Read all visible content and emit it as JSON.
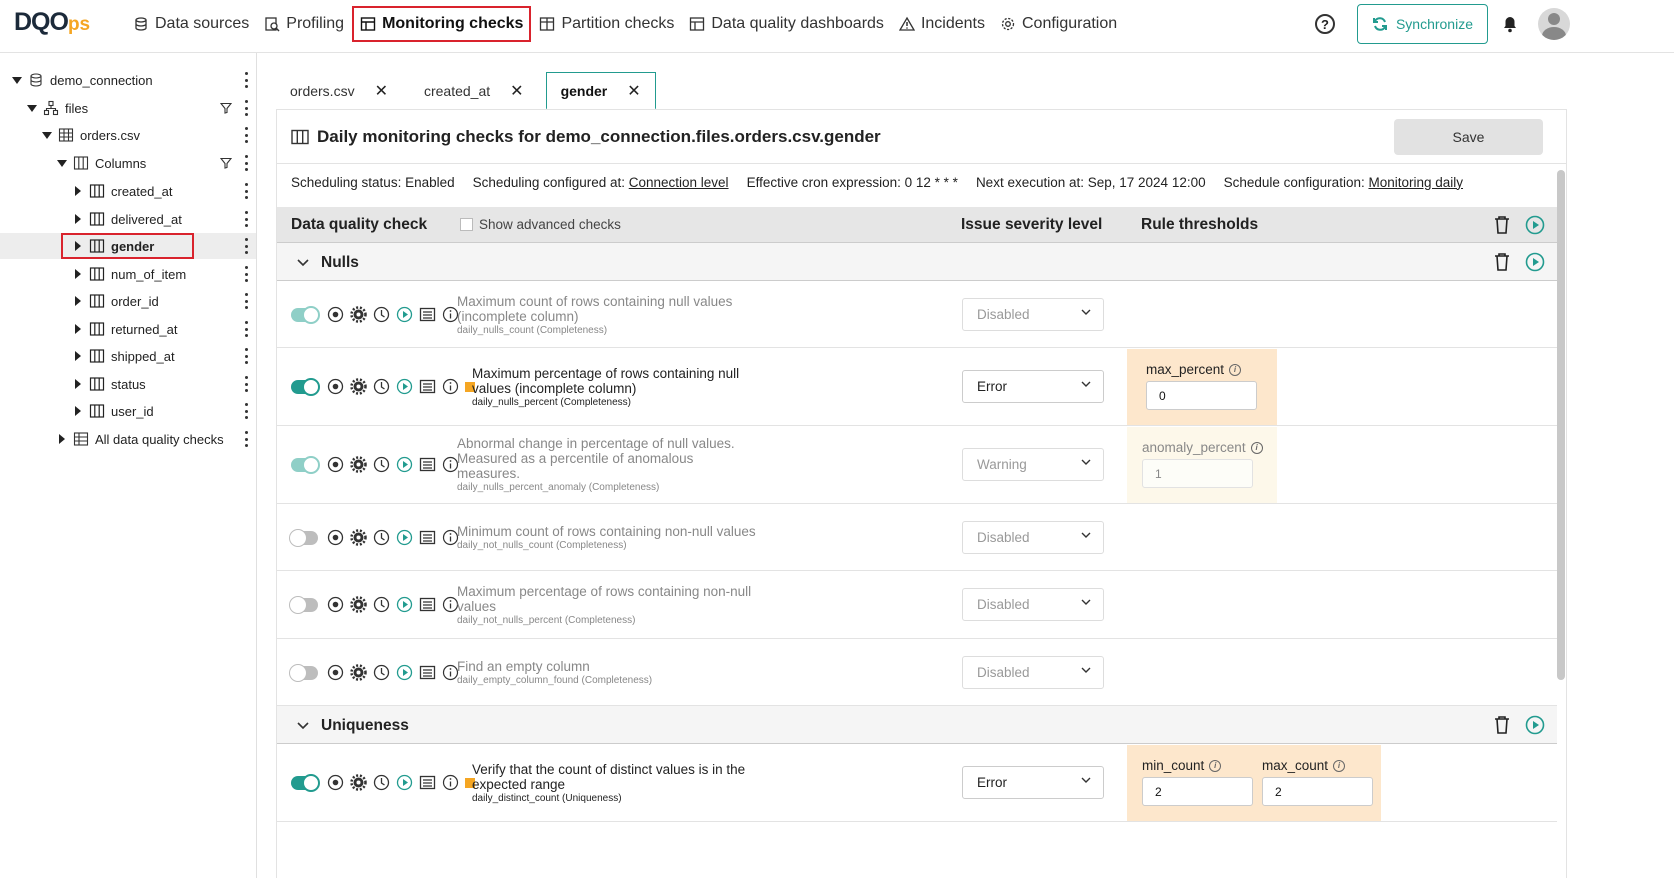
{
  "app": {
    "logo_main": "DQO",
    "logo_sub": "ps"
  },
  "nav": [
    {
      "id": "data-sources",
      "label": "Data sources",
      "icon": "database-icon"
    },
    {
      "id": "profiling",
      "label": "Profiling",
      "icon": "profiling-icon"
    },
    {
      "id": "monitoring-checks",
      "label": "Monitoring checks",
      "icon": "monitoring-icon",
      "active": true
    },
    {
      "id": "partition-checks",
      "label": "Partition checks",
      "icon": "partition-icon"
    },
    {
      "id": "dashboards",
      "label": "Data quality dashboards",
      "icon": "dashboard-icon"
    },
    {
      "id": "incidents",
      "label": "Incidents",
      "icon": "warning-icon"
    },
    {
      "id": "configuration",
      "label": "Configuration",
      "icon": "gear-icon"
    }
  ],
  "top_right": {
    "help": "?",
    "sync_label": "Synchronize"
  },
  "tree": [
    {
      "label": "demo_connection",
      "level": 0,
      "expanded": true,
      "icon": "database-icon"
    },
    {
      "label": "files",
      "level": 1,
      "expanded": true,
      "icon": "schema-icon",
      "filter": true
    },
    {
      "label": "orders.csv",
      "level": 2,
      "expanded": true,
      "icon": "table-icon"
    },
    {
      "label": "Columns",
      "level": 3,
      "expanded": true,
      "icon": "columns-icon",
      "filter": true
    },
    {
      "label": "created_at",
      "level": 4,
      "icon": "column-icon"
    },
    {
      "label": "delivered_at",
      "level": 4,
      "icon": "column-icon"
    },
    {
      "label": "gender",
      "level": 4,
      "icon": "column-icon",
      "selected": true
    },
    {
      "label": "num_of_item",
      "level": 4,
      "icon": "column-icon"
    },
    {
      "label": "order_id",
      "level": 4,
      "icon": "column-icon"
    },
    {
      "label": "returned_at",
      "level": 4,
      "icon": "column-icon"
    },
    {
      "label": "shipped_at",
      "level": 4,
      "icon": "column-icon"
    },
    {
      "label": "status",
      "level": 4,
      "icon": "column-icon"
    },
    {
      "label": "user_id",
      "level": 4,
      "icon": "column-icon"
    },
    {
      "label": "All data quality checks",
      "level": 3,
      "icon": "checks-table-icon"
    }
  ],
  "tabs": [
    {
      "label": "orders.csv"
    },
    {
      "label": "created_at"
    },
    {
      "label": "gender",
      "active": true
    }
  ],
  "panel": {
    "title": "Daily monitoring checks for demo_connection.files.orders.csv.gender",
    "save_label": "Save",
    "sched": {
      "status": "Scheduling status: Enabled",
      "configured_prefix": "Scheduling configured at: ",
      "configured_link": "Connection level",
      "cron": "Effective cron expression: 0 12 * * *",
      "next": "Next execution at: Sep, 17 2024 12:00",
      "config_prefix": "Schedule configuration: ",
      "config_link": "Monitoring daily"
    },
    "header": {
      "check": "Data quality check",
      "advanced": "Show advanced checks",
      "severity": "Issue severity level",
      "thresholds": "Rule thresholds"
    },
    "groups": {
      "nulls": "Nulls",
      "uniqueness": "Uniqueness"
    },
    "checks": [
      {
        "desc1": "Maximum count of rows containing null values",
        "desc2": "(incomplete column)",
        "desc3": "",
        "sub": "daily_nulls_count (Completeness)",
        "severity": "Disabled",
        "state": "on-dim"
      },
      {
        "desc1": "Maximum percentage of rows containing null",
        "desc2": "values (incomplete column)",
        "desc3": "",
        "sub": "daily_nulls_percent (Completeness)",
        "severity": "Error",
        "state": "on",
        "thr": [
          {
            "label": "max_percent",
            "value": "0"
          }
        ]
      },
      {
        "desc1": "Abnormal change in percentage of null values.",
        "desc2": "Measured as a percentile of anomalous",
        "desc3": "measures.",
        "sub": "daily_nulls_percent_anomaly (Completeness)",
        "severity": "Warning",
        "state": "on-dim",
        "thr": [
          {
            "label": "anomaly_percent",
            "value": "1"
          }
        ]
      },
      {
        "desc1": "Minimum count of rows containing non-null values",
        "desc2": "",
        "desc3": "",
        "sub": "daily_not_nulls_count (Completeness)",
        "severity": "Disabled",
        "state": "off"
      },
      {
        "desc1": "Maximum percentage of rows containing non-null",
        "desc2": "values",
        "desc3": "",
        "sub": "daily_not_nulls_percent (Completeness)",
        "severity": "Disabled",
        "state": "off"
      },
      {
        "desc1": "Find an empty column",
        "desc2": "",
        "desc3": "",
        "sub": "daily_empty_column_found (Completeness)",
        "severity": "Disabled",
        "state": "off"
      },
      {
        "desc1": "Verify that the count of distinct values is in the",
        "desc2": "expected range",
        "desc3": "",
        "sub": "daily_distinct_count (Uniqueness)",
        "severity": "Error",
        "state": "on",
        "thr": [
          {
            "label": "min_count",
            "value": "2"
          },
          {
            "label": "max_count",
            "value": "2"
          }
        ]
      }
    ]
  },
  "colors": {
    "accent": "#229b8f",
    "highlight": "#d9232d",
    "threshold_bg": "#fde7cc",
    "severity": "#f5a623"
  }
}
